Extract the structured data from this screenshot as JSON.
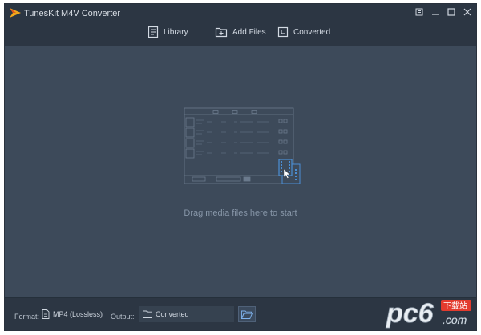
{
  "window": {
    "title": "TunesKit M4V Converter"
  },
  "nav": {
    "library": "Library",
    "add_files": "Add Files",
    "converted": "Converted"
  },
  "main": {
    "drop_hint": "Drag media files here to start"
  },
  "bottom": {
    "format_label": "Format:",
    "format_value": "MP4 (Lossless)",
    "output_label": "Output:",
    "output_value": "Converted"
  },
  "watermark": {
    "text": "pc6",
    "subtext": "下载站",
    "domain": ".com"
  },
  "colors": {
    "background": "#3d4a5a",
    "bar": "#2c3643",
    "accent": "#3a8ee6"
  },
  "icons": [
    "app-logo-icon",
    "menu-icon",
    "minimize-icon",
    "maximize-icon",
    "close-icon",
    "library-icon",
    "add-files-icon",
    "converted-icon",
    "format-file-icon",
    "folder-icon",
    "browse-folder-icon"
  ]
}
